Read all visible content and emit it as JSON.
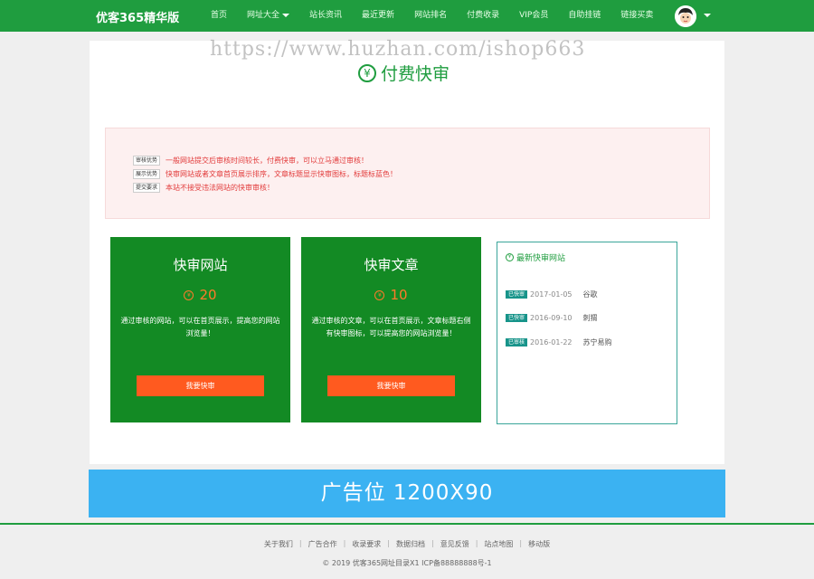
{
  "header": {
    "brand": "优客365精华版",
    "nav": [
      "首页",
      "网址大全",
      "站长资讯",
      "最近更新",
      "网站排名",
      "付费收录",
      "VIP会员",
      "自助挂链",
      "链接买卖"
    ]
  },
  "watermark": "https://www.huzhan.com/ishop663",
  "page": {
    "title": "付费快审",
    "title_icon": "¥"
  },
  "notice": [
    {
      "tag": "审核优势",
      "text": "一般网站提交后审核时间较长，付费快审，可以立马通过审核！"
    },
    {
      "tag": "展示优势",
      "text": "快审网站或者文章首页展示排序，文章标题显示快审图标，标题标蓝色！"
    },
    {
      "tag": "提交要求",
      "text": "本站不接受违法网站的快审审核！"
    }
  ],
  "cards": [
    {
      "title": "快审网站",
      "price_icon": "¥",
      "price": "20",
      "desc": "通过审核的网站，可以在首页展示，提高您的网站浏览量！",
      "button": "我要快审"
    },
    {
      "title": "快审文章",
      "price_icon": "¥",
      "price": "10",
      "desc": "通过审核的文章，可以在首页展示，文章标题右侧有快审图标，可以提高您的网站浏览量！",
      "button": "我要快审"
    }
  ],
  "latest": {
    "title": "最新快审网站",
    "icon": "¥",
    "items": [
      {
        "badge": "已快审",
        "date": "2017-01-05",
        "name": "谷歌"
      },
      {
        "badge": "已快审",
        "date": "2016-09-10",
        "name": "刺猬"
      },
      {
        "badge": "已审核",
        "date": "2016-01-22",
        "name": "苏宁易购"
      }
    ]
  },
  "ad": {
    "text": "广告位  1200X90"
  },
  "footer": {
    "links": [
      "关于我们",
      "广告合作",
      "收录要求",
      "数据归档",
      "意见反馈",
      "站点地图",
      "移动版"
    ],
    "separator": "|",
    "copyright": "© 2019 优客365网址目录X1 ICP备88888888号-1"
  },
  "colors": {
    "brand_green": "#1f9d3f",
    "card_green": "#138a24",
    "accent_orange": "#ff5a1f",
    "ad_blue": "#3bb2f2"
  }
}
